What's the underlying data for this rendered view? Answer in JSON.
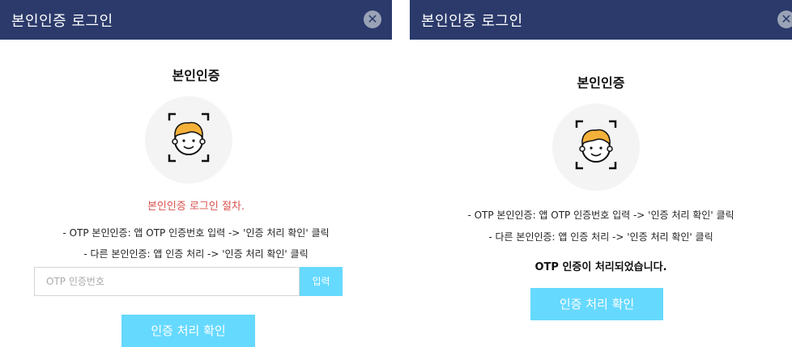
{
  "left_dialog": {
    "title": "본인인증 로그인",
    "close_icon": "close-icon",
    "heading": "본인인증",
    "face_icon": "face-scan-icon",
    "process_text": "본인인증 로그인 절차.",
    "instruction_otp": "- OTP 본인인증: 앱 OTP 인증번호 입력 -> '인증 처리 확인' 클릭",
    "instruction_other": "- 다른 본인인증: 앱 인증 처리 -> '인증 처리 확인' 클릭",
    "otp_placeholder": "OTP 인증번호",
    "otp_value": "",
    "submit_label": "입력",
    "confirm_label": "인증 처리 확인"
  },
  "right_dialog": {
    "title": "본인인증 로그인",
    "close_icon": "close-icon",
    "heading": "본인인증",
    "face_icon": "face-scan-icon",
    "instruction_otp": "- OTP 본인인증: 앱 OTP 인증번호 입력 -> '인증 처리 확인' 클릭",
    "instruction_other": "- 다른 본인인증: 앱 인증 처리 -> '인증 처리 확인' 클릭",
    "status_text": "OTP 인증이 처리되었습니다.",
    "confirm_label": "인증 처리 확인"
  },
  "colors": {
    "header": "#2b3a6b",
    "accent_button": "#66d9ff",
    "warning_text": "#d9534f"
  }
}
